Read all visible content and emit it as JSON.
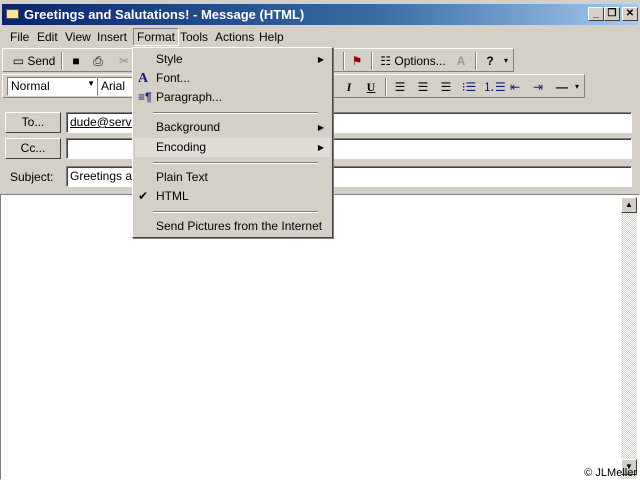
{
  "window": {
    "title": "Greetings and Salutations! - Message (HTML)",
    "minimize": "_",
    "restore": "❐",
    "close": "✕"
  },
  "menubar": [
    "File",
    "Edit",
    "View",
    "Insert",
    "Format",
    "Tools",
    "Actions",
    "Help"
  ],
  "toolbar": {
    "send": "Send",
    "options": "Options..."
  },
  "format_toolbar": {
    "style": "Normal",
    "font": "Arial",
    "italic": "I",
    "underline": "U"
  },
  "fields": {
    "to_button": "To...",
    "to_value": "dude@serve",
    "cc_button": "Cc...",
    "cc_value": "",
    "subject_label": "Subject:",
    "subject_value": "Greetings an"
  },
  "format_menu": {
    "style": "Style",
    "font": "Font...",
    "paragraph": "Paragraph...",
    "background": "Background",
    "encoding": "Encoding",
    "plain_text": "Plain Text",
    "html": "HTML",
    "send_pictures": "Send Pictures from the Internet",
    "checked": "✔"
  },
  "watermark": "© JLMeller"
}
